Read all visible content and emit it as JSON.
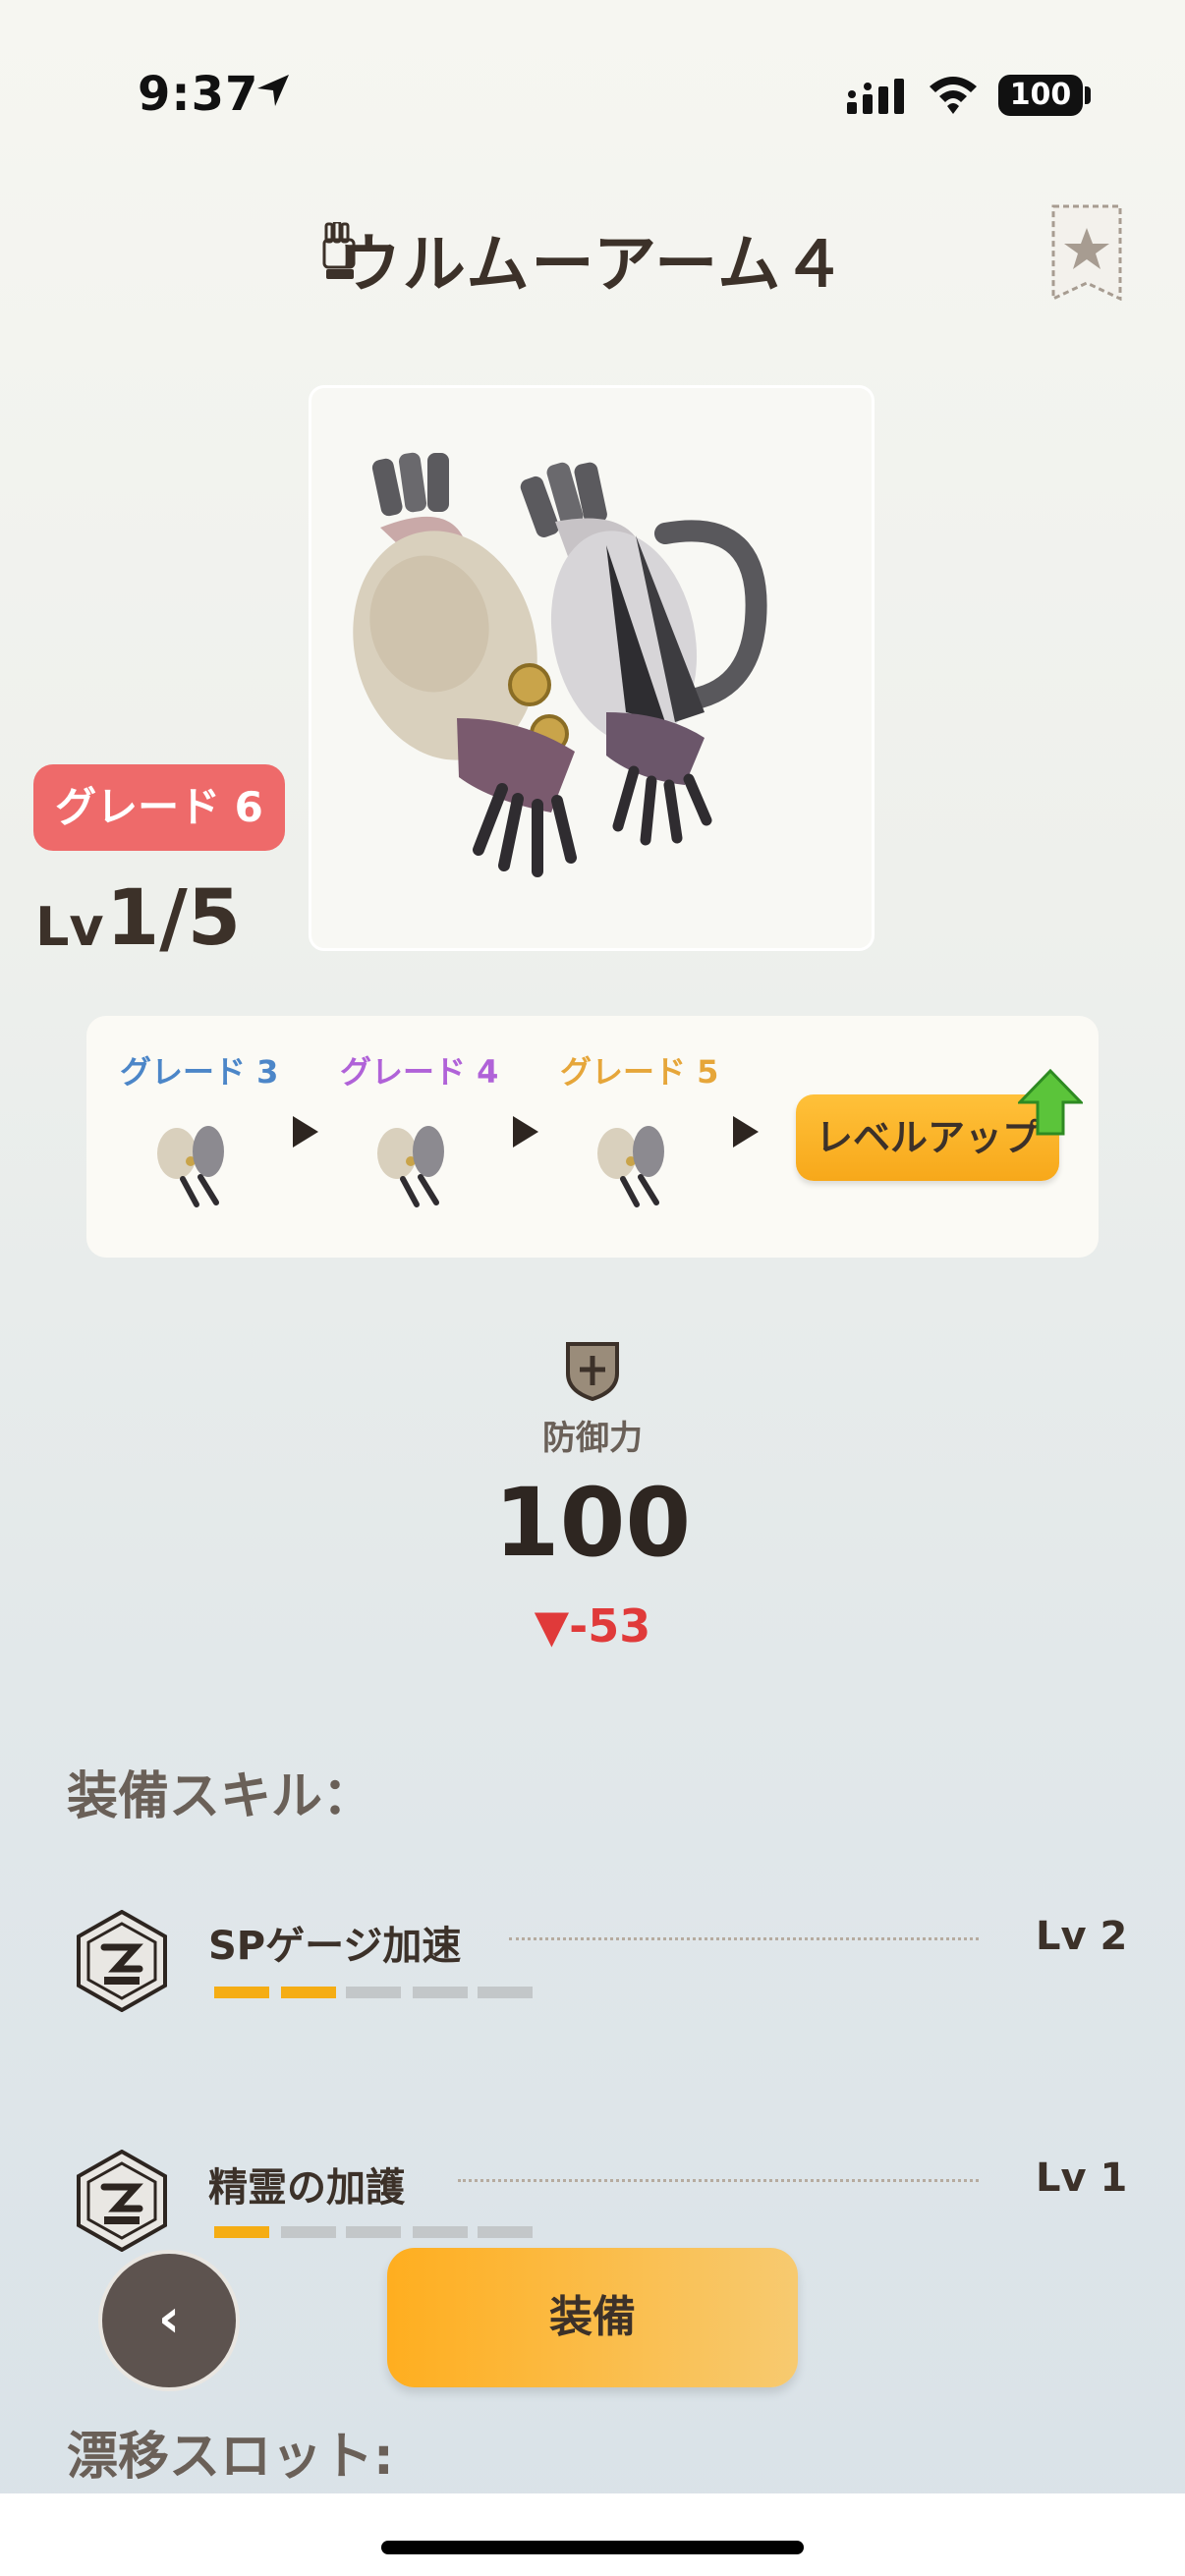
{
  "status_bar": {
    "time": "9:37",
    "battery": "100"
  },
  "header": {
    "title": "ウルムーアーム４"
  },
  "item": {
    "grade_badge": "グレード 6",
    "level_prefix": "Lv",
    "level_value": "1/5"
  },
  "grades": [
    {
      "label": "グレード 3",
      "color": "#4c86c8"
    },
    {
      "label": "グレード 4",
      "color": "#b062d8"
    },
    {
      "label": "グレード 5",
      "color": "#e6a63a"
    }
  ],
  "level_up_label": "レベルアップ",
  "defense": {
    "label": "防御力",
    "value": "100",
    "diff": "▼-53"
  },
  "skills_section_title": "装備スキル：",
  "skills": [
    {
      "name": "SPゲージ加速",
      "level": "Lv 2",
      "progress": 2,
      "max": 5
    },
    {
      "name": "精霊の加護",
      "level": "Lv 1",
      "progress": 1,
      "max": 5
    }
  ],
  "slots_section_title": "漂移スロット:",
  "buttons": {
    "back": "‹",
    "equip": "装備"
  }
}
